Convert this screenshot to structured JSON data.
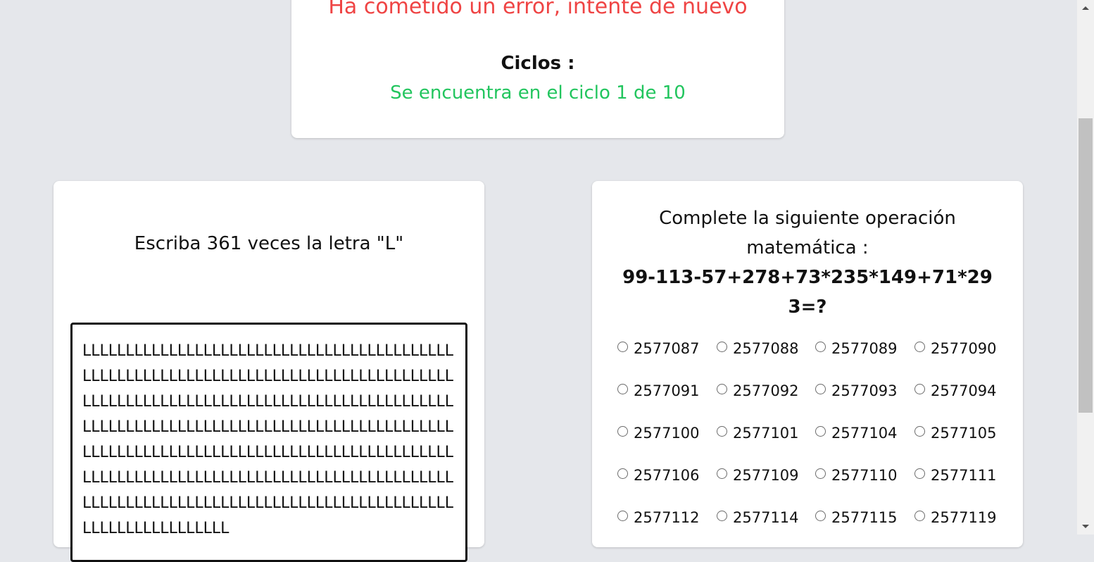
{
  "status": {
    "error_message": "Ha cometido un error, intente de nuevo",
    "cycles_label": "Ciclos :",
    "cycles_text": "Se encuentra en el ciclo 1 de 10"
  },
  "task": {
    "instruction": "Escriba 361 veces la letra \"L\"",
    "typed_text": "LLLLLLLLLLLLLLLLLLLLLLLLLLLLLLLLLLLLLLLLLLLLLLLLLLLLLLLLLLLLLLLLLLLLLLLLLLLLLLLLLLLLLLLLLLLLLLLLLLLLLLLLLLLLLLLLLLLLLLLLLLLLLLLLLLLLLLLLLLLLLLLLLLLLLLLLLLLLLLLLLLLLLLLLLLLLLLLLLLLLLLLLLLLLLLLLLLLLLLLLLLLLLLLLLLLLLLLLLLLLLLLLLLLLLLLLLLLLLLLLLLLLLLLLLLLLLLLLLLLLLLLLLLLLLLLLLLLLLLLLLLLLLLLLLLLLLLLLLLLLLLLLLLLLLLLLLLLLLL"
  },
  "math": {
    "prompt": "Complete la siguiente operación matemática :",
    "expression": "99-113-57+278+73*235*149+71*293=?",
    "options": [
      "2577087",
      "2577088",
      "2577089",
      "2577090",
      "2577091",
      "2577092",
      "2577093",
      "2577094",
      "2577100",
      "2577101",
      "2577104",
      "2577105",
      "2577106",
      "2577109",
      "2577110",
      "2577111",
      "2577112",
      "2577114",
      "2577115",
      "2577119"
    ]
  }
}
